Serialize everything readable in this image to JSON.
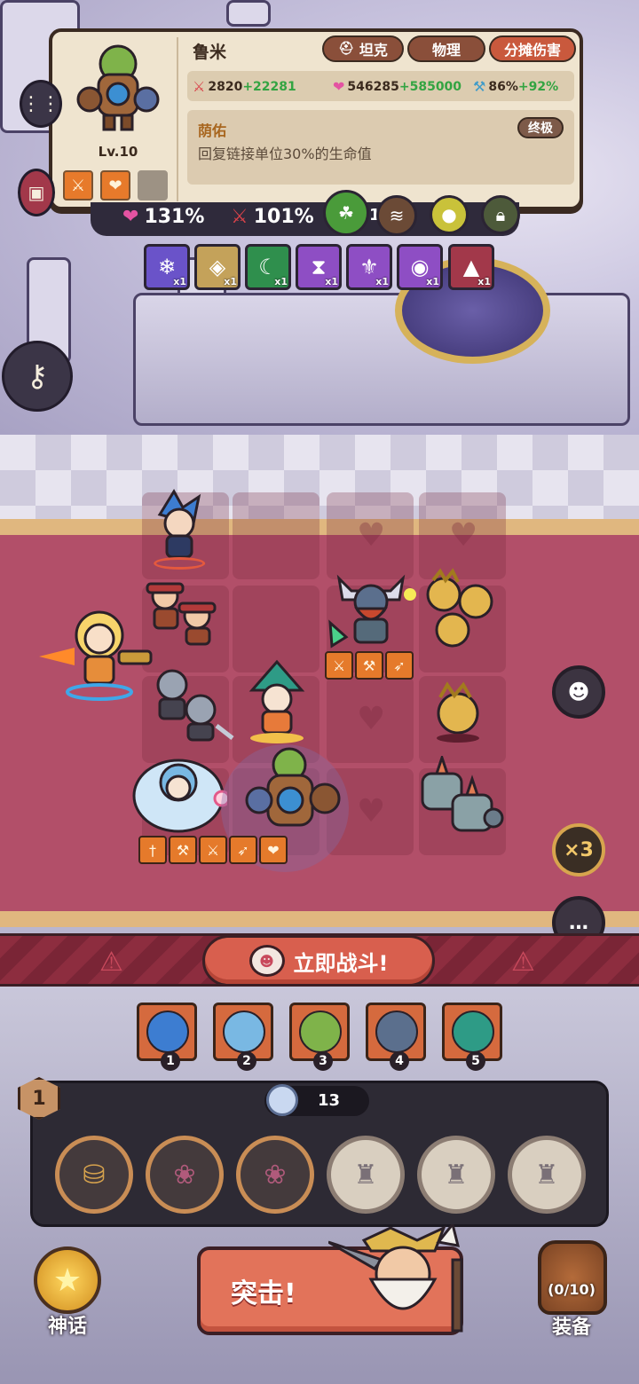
{
  "hero_card": {
    "name": "鲁米",
    "level": "Lv.10",
    "tags": [
      "坦克",
      "物理",
      "分摊伤害"
    ],
    "stats": {
      "attack_base": "2820",
      "attack_bonus": "+22281",
      "hp_base": "546285",
      "hp_bonus": "+585000",
      "crit_base": "86%",
      "crit_bonus": "+92%"
    },
    "skill": {
      "name": "荫佑",
      "tier": "终极",
      "description": "回复链接单位30%的生命值"
    }
  },
  "buff_bar": {
    "hp_percent": "131%",
    "atk_percent": "101%",
    "mid_a": "1",
    "mid_b": "6"
  },
  "relics": [
    {
      "icon": "coral-icon",
      "count": "x1",
      "color": "#6a53c9"
    },
    {
      "icon": "crate-icon",
      "count": "x1",
      "color": "#c4a25a"
    },
    {
      "icon": "moon-icon",
      "count": "x1",
      "color": "#2f8f4d"
    },
    {
      "icon": "hourglass-icon",
      "count": "x1",
      "color": "#8e4ec4"
    },
    {
      "icon": "chest-icon",
      "count": "x1",
      "color": "#8e4ec4"
    },
    {
      "icon": "orb-icon",
      "count": "x1",
      "color": "#8e4ec4"
    },
    {
      "icon": "wizard-hat-icon",
      "count": "x1",
      "color": "#a2384a"
    }
  ],
  "fight_button": {
    "label": "立即战斗!"
  },
  "speed_button": {
    "label": "×3"
  },
  "team": [
    "1",
    "2",
    "3",
    "4",
    "5"
  ],
  "currency": {
    "value": "13",
    "level": "1"
  },
  "bottom": {
    "myth_label": "神话",
    "attack_label": "突击!",
    "gear_label": "装备",
    "gear_count": "(0/10)"
  },
  "colors": {
    "accent": "#d85f4e",
    "carpet": "#b24f69",
    "card_bg": "#efe4cf",
    "bonus_green": "#33a442"
  }
}
